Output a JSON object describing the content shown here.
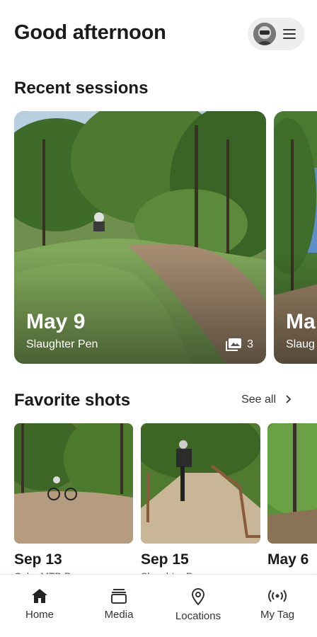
{
  "header": {
    "greeting": "Good afternoon"
  },
  "recent": {
    "title": "Recent sessions",
    "cards": [
      {
        "date": "May 9",
        "location": "Slaughter Pen",
        "media_count": "3"
      },
      {
        "date": "Ma",
        "location": "Slaug"
      }
    ]
  },
  "favorites": {
    "title": "Favorite shots",
    "see_all": "See all",
    "shots": [
      {
        "date": "Sep 13",
        "subtitle": "Coler MTB P..."
      },
      {
        "date": "Sep 15",
        "subtitle": "Slaughter P..."
      },
      {
        "date": "May 6",
        "subtitle": ""
      }
    ]
  },
  "tabs": [
    {
      "label": "Home",
      "icon": "home-icon"
    },
    {
      "label": "Media",
      "icon": "media-stack-icon"
    },
    {
      "label": "Locations",
      "icon": "location-pin-icon"
    },
    {
      "label": "My Tag",
      "icon": "radio-signal-icon"
    }
  ]
}
